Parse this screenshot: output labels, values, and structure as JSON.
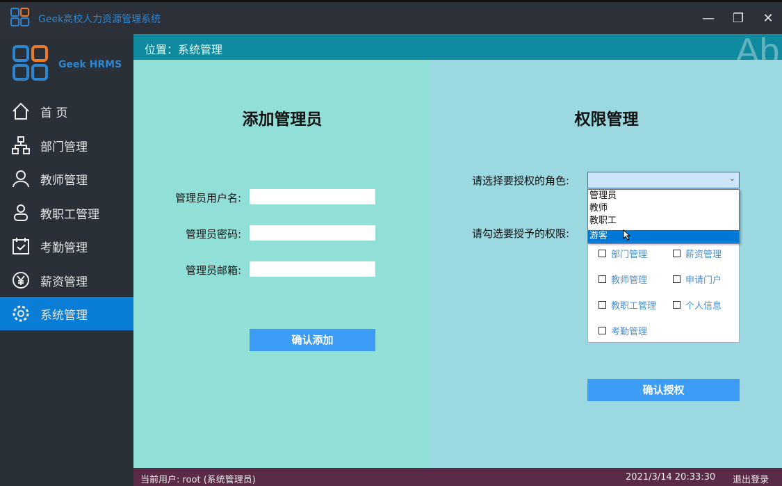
{
  "window": {
    "title": "Geek高校人力资源管理系统",
    "minimize": "—",
    "maximize": "❐",
    "close": "✕"
  },
  "brand": "Geek HRMS",
  "nav": [
    {
      "label": "首 页"
    },
    {
      "label": "部门管理"
    },
    {
      "label": "教师管理"
    },
    {
      "label": "教职工管理"
    },
    {
      "label": "考勤管理"
    },
    {
      "label": "薪资管理"
    },
    {
      "label": "系统管理"
    }
  ],
  "header": {
    "location": "位置：系统管理",
    "watermark": "Abi"
  },
  "add_admin": {
    "title": "添加管理员",
    "username_label": "管理员用户名:",
    "password_label": "管理员密码:",
    "email_label": "管理员邮箱:",
    "username": "",
    "password": "",
    "email": "",
    "submit": "确认添加"
  },
  "permissions": {
    "title": "权限管理",
    "role_label": "请选择要授权的角色:",
    "perm_label": "请勾选要授予的权限:",
    "role_value": "",
    "role_options": [
      "管理员",
      "教师",
      "教职工",
      "游客"
    ],
    "highlighted_option": "游客",
    "checkboxes": [
      "部门管理",
      "薪资管理",
      "教师管理",
      "申请门户",
      "教职工管理",
      "个人信息",
      "考勤管理"
    ],
    "submit": "确认授权"
  },
  "footer": {
    "user": "当前用户:  root (系统管理员)",
    "datetime": "2021/3/14 20:33:30",
    "logout": "退出登录"
  },
  "colors": {
    "accent": "#0a7dd6",
    "button": "#3d9cf5",
    "footer": "#5a2a48",
    "header": "#0f8a9e"
  }
}
